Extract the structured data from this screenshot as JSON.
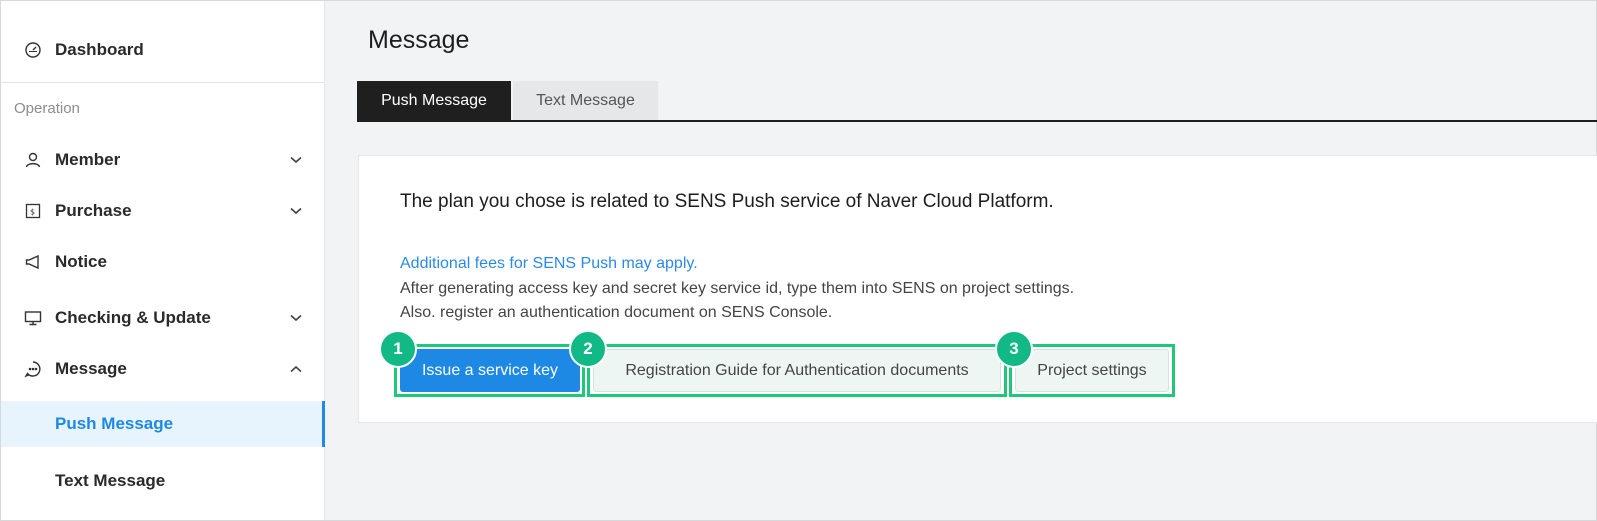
{
  "sidebar": {
    "dashboard": "Dashboard",
    "section": "Operation",
    "items": [
      {
        "label": "Member",
        "icon": "user-icon",
        "expanded": false
      },
      {
        "label": "Purchase",
        "icon": "receipt-icon",
        "expanded": false
      },
      {
        "label": "Notice",
        "icon": "megaphone-icon"
      },
      {
        "label": "Checking & Update",
        "icon": "monitor-icon",
        "expanded": false
      },
      {
        "label": "Message",
        "icon": "chat-icon",
        "expanded": true
      }
    ],
    "sub_items": [
      {
        "label": "Push Message",
        "active": true
      },
      {
        "label": "Text Message",
        "active": false
      }
    ]
  },
  "main": {
    "title": "Message",
    "tabs": [
      {
        "label": "Push Message",
        "active": true
      },
      {
        "label": "Text Message",
        "active": false
      }
    ],
    "card": {
      "title": "The plan you chose is related to SENS Push service of Naver Cloud Platform.",
      "link": "Additional fees for SENS Push may apply.",
      "lines": [
        "After generating access key and secret key service id, type them into SENS on project settings.",
        "Also. register an authentication document on SENS Console."
      ],
      "buttons": {
        "issue": "Issue a service key",
        "guide": "Registration Guide for Authentication documents",
        "project": "Project settings"
      }
    },
    "badges": [
      "1",
      "2",
      "3"
    ]
  },
  "colors": {
    "accent": "#1e88e5",
    "highlight": "#1ec77a",
    "badge": "#13b887",
    "tab_active": "#1f1f1f"
  }
}
